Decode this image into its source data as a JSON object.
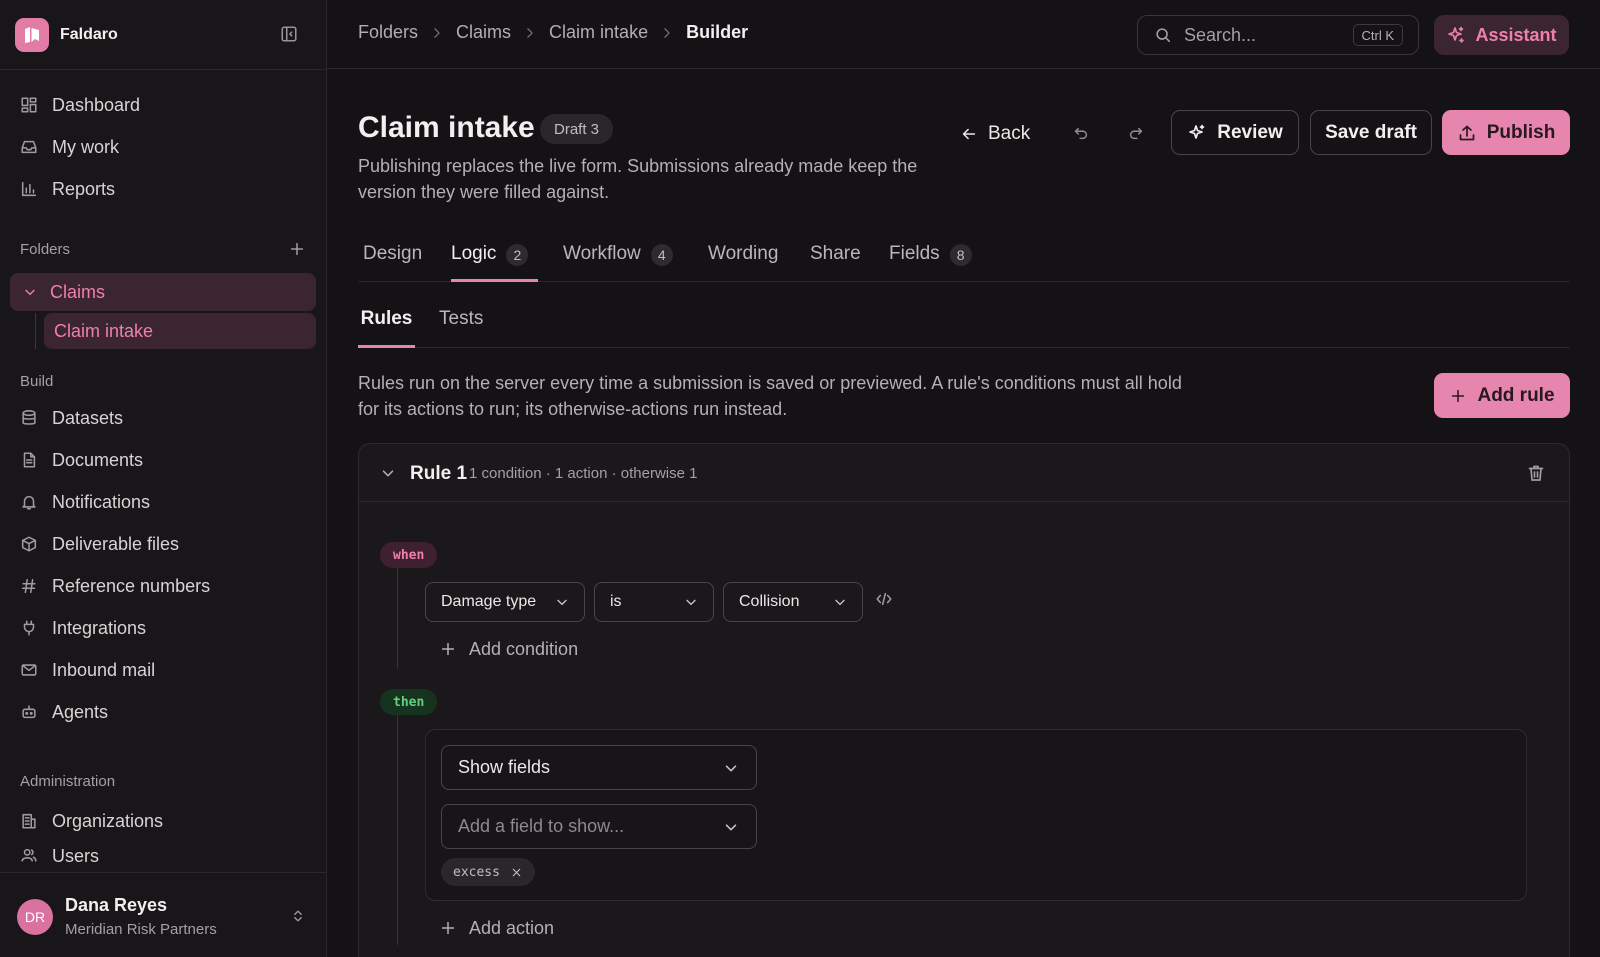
{
  "brand": {
    "name": "Faldaro",
    "accent": "#e685ae"
  },
  "sidebar": {
    "nav_top": [
      {
        "label": "Dashboard",
        "icon": "dashboard-icon"
      },
      {
        "label": "My work",
        "icon": "inbox-icon"
      },
      {
        "label": "Reports",
        "icon": "bar-chart-icon"
      }
    ],
    "folders_label": "Folders",
    "folders": [
      {
        "label": "Claims",
        "children": [
          {
            "label": "Claim intake"
          }
        ]
      }
    ],
    "build_label": "Build",
    "build_items": [
      {
        "label": "Datasets",
        "icon": "database-icon"
      },
      {
        "label": "Documents",
        "icon": "document-icon"
      },
      {
        "label": "Notifications",
        "icon": "bell-icon"
      },
      {
        "label": "Deliverable files",
        "icon": "package-icon"
      },
      {
        "label": "Reference numbers",
        "icon": "hash-icon"
      },
      {
        "label": "Integrations",
        "icon": "plug-icon"
      },
      {
        "label": "Inbound mail",
        "icon": "mail-icon"
      },
      {
        "label": "Agents",
        "icon": "bot-icon"
      }
    ],
    "admin_label": "Administration",
    "admin_items": [
      {
        "label": "Organizations",
        "icon": "building-icon"
      },
      {
        "label": "Users",
        "icon": "users-icon"
      }
    ],
    "user": {
      "initials": "DR",
      "name": "Dana Reyes",
      "org": "Meridian Risk Partners"
    }
  },
  "topbar": {
    "breadcrumbs": [
      "Folders",
      "Claims",
      "Claim intake",
      "Builder"
    ],
    "search_placeholder": "Search...",
    "search_shortcut": "Ctrl K",
    "assistant_label": "Assistant"
  },
  "page": {
    "title": "Claim intake",
    "draft_badge": "Draft 3",
    "description": "Publishing replaces the live form. Submissions already made keep the version they were filled against.",
    "back_label": "Back",
    "review_label": "Review",
    "save_draft_label": "Save draft",
    "publish_label": "Publish"
  },
  "tabs": [
    {
      "label": "Design",
      "count": null
    },
    {
      "label": "Logic",
      "count": "2"
    },
    {
      "label": "Workflow",
      "count": "4"
    },
    {
      "label": "Wording",
      "count": null
    },
    {
      "label": "Share",
      "count": null
    },
    {
      "label": "Fields",
      "count": "8"
    }
  ],
  "active_tab": "Logic",
  "subtabs": [
    "Rules",
    "Tests"
  ],
  "active_subtab": "Rules",
  "rules_description": "Rules run on the server every time a submission is saved or previewed. A rule's conditions must all hold for its actions to run; its otherwise-actions run instead.",
  "add_rule_label": "Add rule",
  "rule": {
    "name": "Rule 1",
    "meta": "1 condition · 1 action · otherwise 1",
    "when_label": "when",
    "condition": {
      "field": "Damage type",
      "operator": "is",
      "value": "Collision"
    },
    "add_condition_label": "Add condition",
    "then_label": "then",
    "action": {
      "type": "Show fields",
      "field_placeholder": "Add a field to show...",
      "chips": [
        "excess"
      ]
    },
    "add_action_label": "Add action"
  }
}
